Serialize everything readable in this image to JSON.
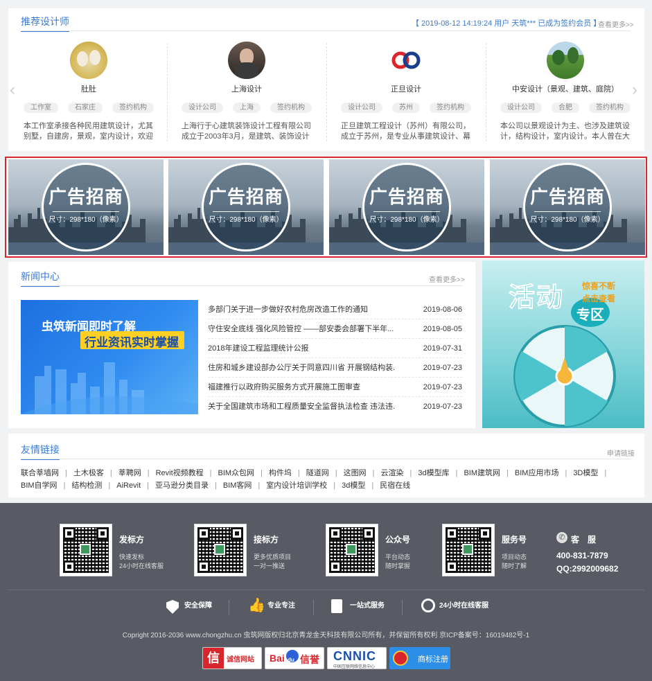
{
  "designers": {
    "title": "推荐设计师",
    "ticker": "【 2019-08-12 14:19:24 用户 天筑*** 已成为签约会员 】",
    "more": "查看更多>>",
    "cards": [
      {
        "name": "肚肚",
        "tags": [
          "工作室",
          "石家庄",
          "签约机构"
        ],
        "desc": "本工作室承接各种民用建筑设计，尤其别墅，自建房，景观，室内设计，欢迎各位"
      },
      {
        "name": "上海设计",
        "tags": [
          "设计公司",
          "上海",
          "签约机构"
        ],
        "desc": "上海行于心建筑装饰设计工程有限公司成立于2003年3月，是建筑、装饰设计界一"
      },
      {
        "name": "正旦设计",
        "tags": [
          "设计公司",
          "苏州",
          "签约机构"
        ],
        "desc": "正旦建筑工程设计（苏州）有限公司，成立于苏州，是专业从事建筑设计、幕墙设"
      },
      {
        "name": "中安设计（景观、建筑、庭院）",
        "tags": [
          "设计公司",
          "合肥",
          "签约机构"
        ],
        "desc": "本公司以景观设计为主、也涉及建筑设计，结构设计，室内设计。本人曾在大型"
      }
    ],
    "prev_icon": "chevron-left-icon",
    "next_icon": "chevron-right-icon"
  },
  "ads": [
    {
      "title": "广告招商",
      "size": "尺寸：298*180（像素）"
    },
    {
      "title": "广告招商",
      "size": "尺寸：298*180（像素）"
    },
    {
      "title": "广告招商",
      "size": "尺寸：298*180（像素）"
    },
    {
      "title": "广告招商",
      "size": "尺寸：298*180（像素）"
    }
  ],
  "news": {
    "title": "新闻中心",
    "more": "查看更多>>",
    "banner_line1": "虫筑新闻即时了解",
    "banner_line2": "行业资讯实时掌握",
    "items": [
      {
        "title": "多部门关于进一步做好农村危房改造工作的通知",
        "date": "2019-08-06"
      },
      {
        "title": "守住安全底线 强化风险管控 ——部安委会部署下半年...",
        "date": "2019-08-05"
      },
      {
        "title": "2018年建设工程监理统计公报",
        "date": "2019-07-31"
      },
      {
        "title": "住房和城乡建设部办公厅关于同意四川省 开展钢结构装...",
        "date": "2019-07-23"
      },
      {
        "title": "福建推行以政府购买服务方式开展施工图审查",
        "date": "2019-07-23"
      },
      {
        "title": "关于全国建筑市场和工程质量安全监督执法检查 违法违...",
        "date": "2019-07-23"
      }
    ]
  },
  "activity": {
    "big": "活动",
    "small": "专区",
    "tag1": "惊喜不断",
    "tag2": "点击查看"
  },
  "friends": {
    "title": "友情链接",
    "apply": "申请链接",
    "links": [
      "联合莘墙网",
      "土木极客",
      "莘聘网",
      "Revit视频教程",
      "BIM众包网",
      "构件坞",
      "隧道网",
      "这图网",
      "云渲染",
      "3d模型库",
      "BIM建筑网",
      "BIM应用市场",
      "3D模型",
      "BIM自学网",
      "结构检测",
      "AiRevit",
      "亚马逊分类目录",
      "BIM客网",
      "室内设计培训学校",
      "3d模型",
      "民宿在线"
    ]
  },
  "footer": {
    "qrs": [
      {
        "title": "发标方",
        "line1": "快速发标",
        "line2": "24小时在线客服"
      },
      {
        "title": "接标方",
        "line1": "更多优质项目",
        "line2": "一对一推送"
      },
      {
        "title": "公众号",
        "line1": "平台动态",
        "line2": "随时掌握"
      },
      {
        "title": "服务号",
        "line1": "项目动态",
        "line2": "随时了解"
      }
    ],
    "service_label": "客　服",
    "phone": "400-831-7879",
    "qq": "QQ:2992009682",
    "features": [
      "安全保障",
      "专业专注",
      "一站式服务",
      "24小时在线客服"
    ],
    "copyright": "Copright 2016-2036 www.chongzhu.cn 虫筑网版权归北京青龙金天科技有限公司所有，并保留所有权利 京ICP备案号：16019482号-1",
    "badges": [
      "诚信网站",
      "Bai",
      "du",
      "信誉",
      "CNNIC",
      "中国互联网络信息中心",
      "商标注册"
    ],
    "colors": {
      "bg": "#585b63",
      "accent": "#3a7bd5",
      "ad_border": "#d9262c"
    }
  }
}
